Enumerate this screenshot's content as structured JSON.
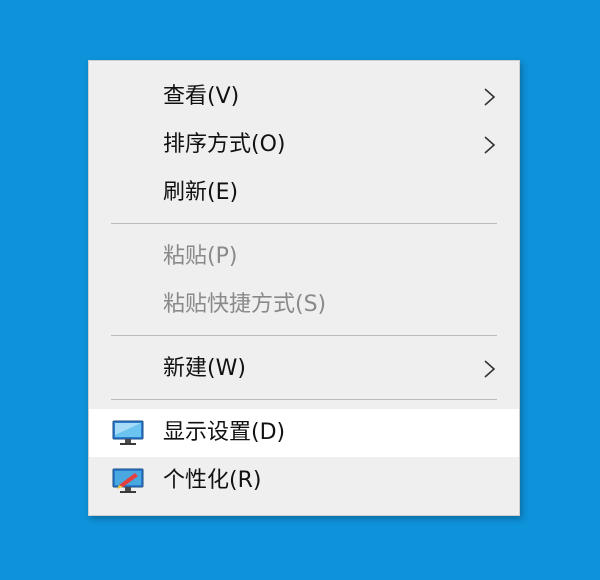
{
  "context_menu": {
    "items": [
      {
        "label": "查看(V)",
        "has_submenu": true,
        "enabled": true
      },
      {
        "label": "排序方式(O)",
        "has_submenu": true,
        "enabled": true
      },
      {
        "label": "刷新(E)",
        "has_submenu": false,
        "enabled": true
      },
      {
        "label": "粘贴(P)",
        "has_submenu": false,
        "enabled": false
      },
      {
        "label": "粘贴快捷方式(S)",
        "has_submenu": false,
        "enabled": false
      },
      {
        "label": "新建(W)",
        "has_submenu": true,
        "enabled": true
      },
      {
        "label": "显示设置(D)",
        "has_submenu": false,
        "enabled": true,
        "icon": "display-icon",
        "hovered": true
      },
      {
        "label": "个性化(R)",
        "has_submenu": false,
        "enabled": true,
        "icon": "personalize-icon"
      }
    ]
  },
  "colors": {
    "desktop_background": "#0e92da",
    "menu_background": "#efefef",
    "disabled_text": "#8a8a8a",
    "highlight_background": "#ffffff"
  }
}
